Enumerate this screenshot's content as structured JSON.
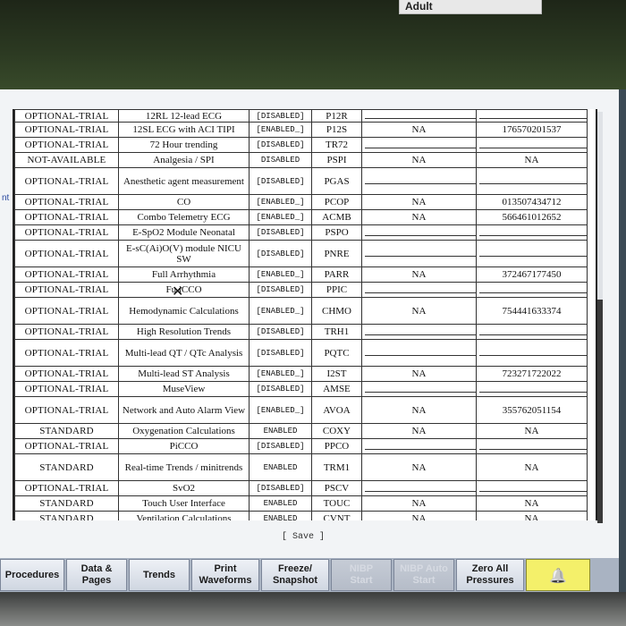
{
  "header": {
    "patient_type": "Adult"
  },
  "left_note": "nt",
  "table": {
    "partial_top_row": {
      "status": "OPTIONAL-TRIAL",
      "name": "12RL 12-lead ECG",
      "state": "[DISABLED]",
      "code": "P12R"
    },
    "rows": [
      {
        "status": "OPTIONAL-TRIAL",
        "name": "12SL ECG with ACI TIPI",
        "state": "[ENABLED_]",
        "code": "P12S",
        "key": "NA",
        "value": "176570201537"
      },
      {
        "status": "OPTIONAL-TRIAL",
        "name": "72 Hour trending",
        "state": "[DISABLED]",
        "code": "TR72",
        "key": "",
        "value": ""
      },
      {
        "status": "NOT-AVAILABLE",
        "name": "Analgesia / SPI",
        "state": "DISABLED",
        "code": "PSPI",
        "key": "NA",
        "value": "NA"
      },
      {
        "status": "OPTIONAL-TRIAL",
        "name": "Anesthetic agent measurement",
        "state": "[DISABLED]",
        "code": "PGAS",
        "key": "",
        "value": ""
      },
      {
        "status": "OPTIONAL-TRIAL",
        "name": "CO",
        "state": "[ENABLED_]",
        "code": "PCOP",
        "key": "NA",
        "value": "013507434712"
      },
      {
        "status": "OPTIONAL-TRIAL",
        "name": "Combo Telemetry ECG",
        "state": "[ENABLED_]",
        "code": "ACMB",
        "key": "NA",
        "value": "566461012652"
      },
      {
        "status": "OPTIONAL-TRIAL",
        "name": "E-SpO2 Module Neonatal",
        "state": "[DISABLED]",
        "code": "PSPO",
        "key": "",
        "value": ""
      },
      {
        "status": "OPTIONAL-TRIAL",
        "name": "E-sC(Ai)O(V) module NICU SW",
        "state": "[DISABLED]",
        "code": "PNRE",
        "key": "",
        "value": ""
      },
      {
        "status": "OPTIONAL-TRIAL",
        "name": "Full Arrhythmia",
        "state": "[ENABLED_]",
        "code": "PARR",
        "key": "NA",
        "value": "372467177450"
      },
      {
        "status": "OPTIONAL-TRIAL",
        "name": "Fu  iCCO",
        "state": "[DISABLED]",
        "code": "PPIC",
        "key": "",
        "value": ""
      },
      {
        "status": "OPTIONAL-TRIAL",
        "name": "Hemodynamic Calculations",
        "state": "[ENABLED_]",
        "code": "CHMO",
        "key": "NA",
        "value": "754441633374"
      },
      {
        "status": "OPTIONAL-TRIAL",
        "name": "High Resolution Trends",
        "state": "[DISABLED]",
        "code": "TRH1",
        "key": "",
        "value": ""
      },
      {
        "status": "OPTIONAL-TRIAL",
        "name": "Multi-lead QT / QTc Analysis",
        "state": "[DISABLED]",
        "code": "PQTC",
        "key": "",
        "value": ""
      },
      {
        "status": "OPTIONAL-TRIAL",
        "name": "Multi-lead ST Analysis",
        "state": "[ENABLED_]",
        "code": "I2ST",
        "key": "NA",
        "value": "723271722022"
      },
      {
        "status": "OPTIONAL-TRIAL",
        "name": "MuseView",
        "state": "[DISABLED]",
        "code": "AMSE",
        "key": "",
        "value": ""
      },
      {
        "status": "OPTIONAL-TRIAL",
        "name": "Network and Auto Alarm View",
        "state": "[ENABLED_]",
        "code": "AVOA",
        "key": "NA",
        "value": "355762051154"
      },
      {
        "status": "STANDARD",
        "name": "Oxygenation Calculations",
        "state": "ENABLED",
        "code": "COXY",
        "key": "NA",
        "value": "NA"
      },
      {
        "status": "OPTIONAL-TRIAL",
        "name": "PiCCO",
        "state": "[DISABLED]",
        "code": "PPCO",
        "key": "",
        "value": ""
      },
      {
        "status": "STANDARD",
        "name": "Real-time Trends / minitrends",
        "state": "ENABLED",
        "code": "TRM1",
        "key": "NA",
        "value": "NA"
      },
      {
        "status": "OPTIONAL-TRIAL",
        "name": "SvO2",
        "state": "[DISABLED]",
        "code": "PSCV",
        "key": "",
        "value": ""
      },
      {
        "status": "STANDARD",
        "name": "Touch User Interface",
        "state": "ENABLED",
        "code": "TOUC",
        "key": "NA",
        "value": "NA"
      },
      {
        "status": "STANDARD",
        "name": "Ventilation Calculations",
        "state": "ENABLED",
        "code": "CVNT",
        "key": "NA",
        "value": "NA"
      }
    ]
  },
  "save_label": "[ Save ]",
  "softkeys": [
    {
      "label": "Procedures",
      "state": "normal"
    },
    {
      "label": "Data &\nPages",
      "state": "normal"
    },
    {
      "label": "Trends",
      "state": "normal"
    },
    {
      "label": "Print\nWaveforms",
      "state": "normal"
    },
    {
      "label": "Freeze/\nSnapshot",
      "state": "normal"
    },
    {
      "label": "NIBP\nStart",
      "state": "disabled"
    },
    {
      "label": "NIBP Auto\nStart",
      "state": "disabled"
    },
    {
      "label": "Zero All\nPressures",
      "state": "normal"
    },
    {
      "label": "",
      "state": "alarm",
      "icon": "alarm-bell-icon"
    }
  ],
  "colors": {
    "alarm_key": "#f4f06a",
    "softbar": "#a9b3c2"
  }
}
